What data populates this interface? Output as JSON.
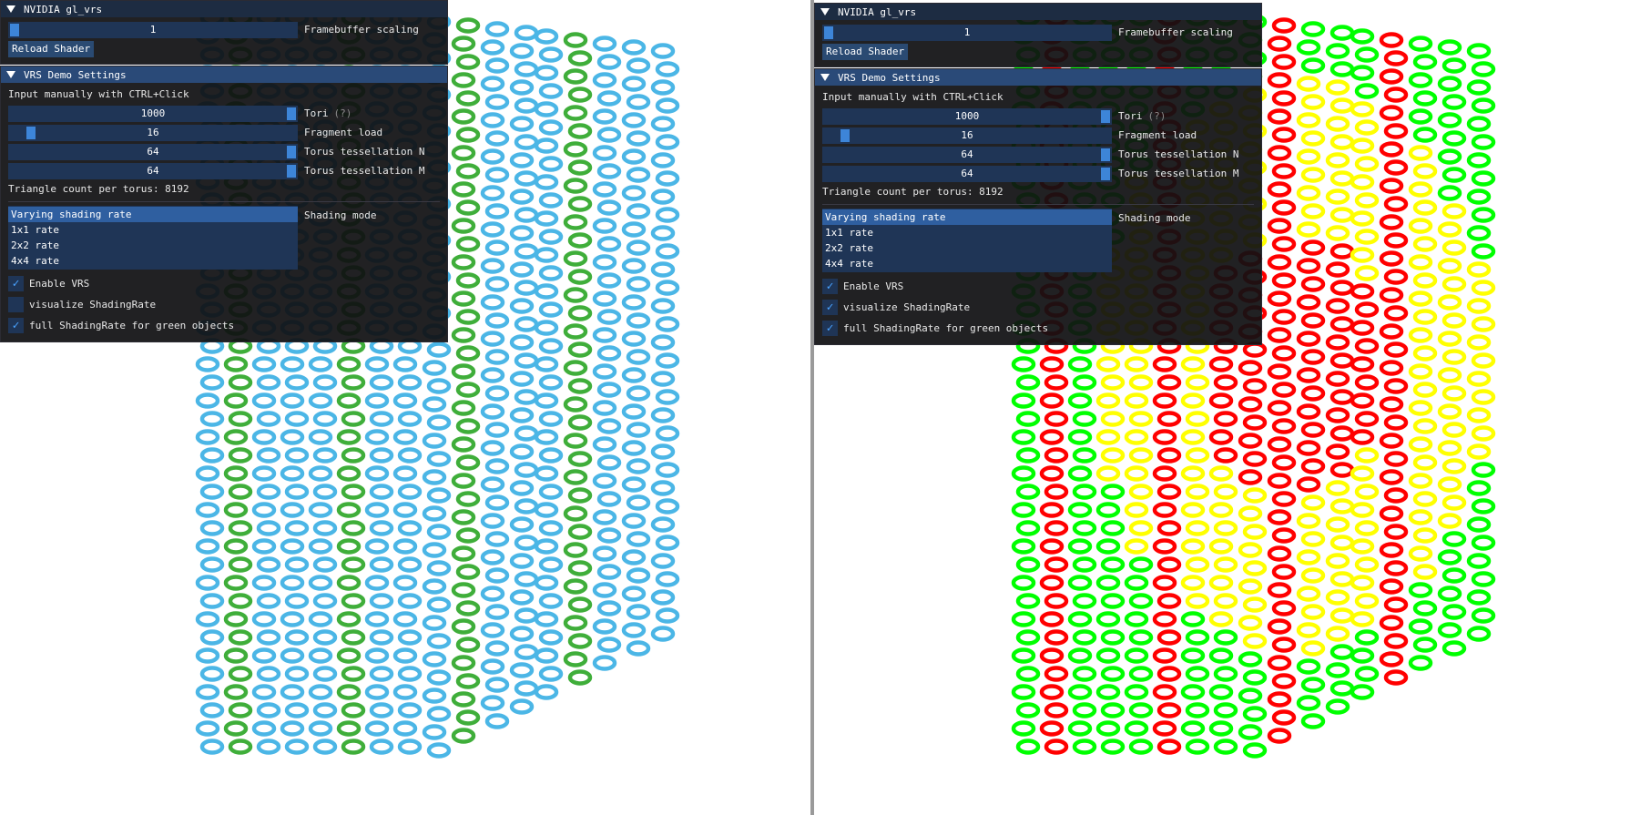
{
  "left_panel": {
    "window1": {
      "title": "NVIDIA gl_vrs",
      "framebuffer_scaling": {
        "value": "1",
        "label": "Framebuffer scaling",
        "fraction": 0.0
      },
      "reload_button": "Reload Shader"
    },
    "window2": {
      "title": "VRS Demo Settings",
      "hint": "Input manually with CTRL+Click",
      "tori": {
        "value": "1000",
        "label": "Tori",
        "help": "(?)",
        "fraction": 1.0
      },
      "fragment_load": {
        "value": "16",
        "label": "Fragment load",
        "fraction": 0.06
      },
      "tess_n": {
        "value": "64",
        "label": "Torus tessellation N",
        "fraction": 1.0
      },
      "tess_m": {
        "value": "64",
        "label": "Torus tessellation M",
        "fraction": 1.0
      },
      "triangle_count": "Triangle count per torus: 8192",
      "shading_mode_label": "Shading mode",
      "shading_modes": [
        "Varying shading rate",
        "1x1 rate",
        "2x2 rate",
        "4x4 rate"
      ],
      "selected_mode": "Varying shading rate",
      "enable_vrs": {
        "label": "Enable VRS",
        "checked": true
      },
      "visualize": {
        "label": "visualize ShadingRate",
        "checked": false
      },
      "full_green": {
        "label": "full ShadingRate for green objects",
        "checked": true
      }
    }
  },
  "right_panel": {
    "window1": {
      "title": "NVIDIA gl_vrs",
      "framebuffer_scaling": {
        "value": "1",
        "label": "Framebuffer scaling",
        "fraction": 0.0
      },
      "reload_button": "Reload Shader"
    },
    "window2": {
      "title": "VRS Demo Settings",
      "hint": "Input manually with CTRL+Click",
      "tori": {
        "value": "1000",
        "label": "Tori",
        "help": "(?)",
        "fraction": 1.0
      },
      "fragment_load": {
        "value": "16",
        "label": "Fragment load",
        "fraction": 0.06
      },
      "tess_n": {
        "value": "64",
        "label": "Torus tessellation N",
        "fraction": 1.0
      },
      "tess_m": {
        "value": "64",
        "label": "Torus tessellation M",
        "fraction": 1.0
      },
      "triangle_count": "Triangle count per torus: 8192",
      "shading_mode_label": "Shading mode",
      "shading_modes": [
        "Varying shading rate",
        "1x1 rate",
        "2x2 rate",
        "4x4 rate"
      ],
      "selected_mode": "Varying shading rate",
      "enable_vrs": {
        "label": "Enable VRS",
        "checked": true
      },
      "visualize": {
        "label": "visualize ShadingRate",
        "checked": true
      },
      "full_green": {
        "label": "full ShadingRate for green objects",
        "checked": true
      }
    }
  },
  "colors": {
    "left_torus_blue": "#4bb6e6",
    "left_torus_green": "#3fae3a",
    "right_green": "#00ff00",
    "right_yellow": "#ffff00",
    "right_red": "#ff0000"
  }
}
